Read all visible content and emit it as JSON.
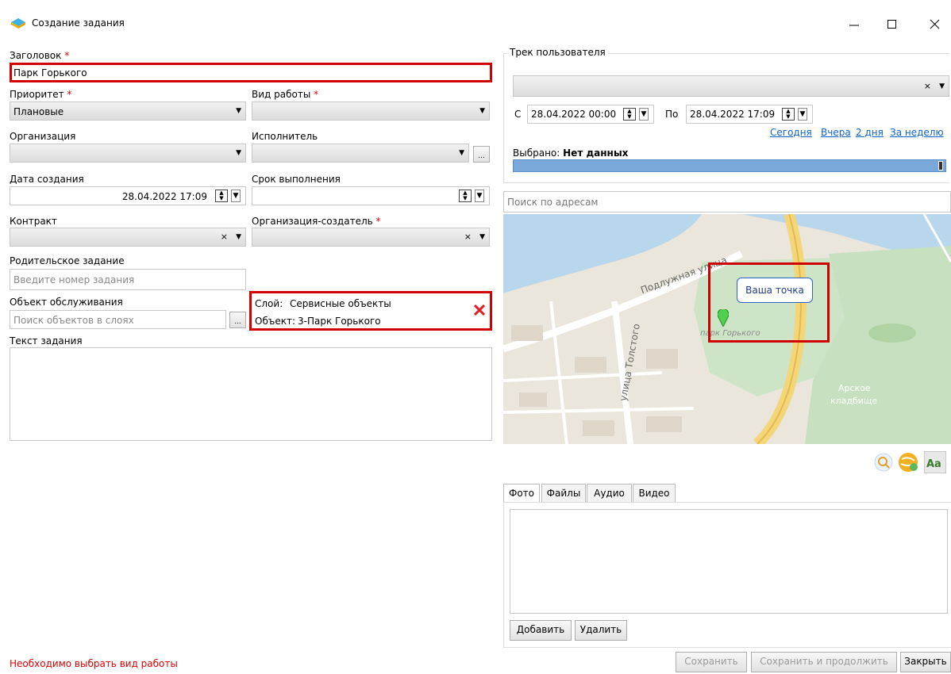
{
  "window": {
    "title": "Создание задания"
  },
  "left": {
    "title_label": "Заголовок",
    "title_value": "Парк Горького",
    "priority_label": "Приоритет",
    "priority_value": "Плановые",
    "worktype_label": "Вид работы",
    "org_label": "Организация",
    "executor_label": "Исполнитель",
    "created_label": "Дата создания",
    "created_value": "28.04.2022 17:09",
    "deadline_label": "Срок выполнения",
    "contract_label": "Контракт",
    "creator_org_label": "Организация-создатель",
    "parent_label": "Родительское задание",
    "parent_placeholder": "Введите номер задания",
    "object_label": "Объект обслуживания",
    "object_placeholder": "Поиск объектов в слоях",
    "layer_label": "Слой:",
    "layer_value": "Сервисные объекты",
    "object_info_label": "Объект:",
    "object_info_value": "3-Парк Горького",
    "text_label": "Текст задания",
    "ellipsis": "...",
    "error": "Необходимо выбрать вид работы"
  },
  "track": {
    "legend": "Трек пользователя",
    "from_label": "С",
    "from_value": "28.04.2022 00:00",
    "to_label": "По",
    "to_value": "28.04.2022 17:09",
    "links": [
      "Сегодня",
      "Вчера",
      "2 дня",
      "За неделю"
    ],
    "selected_label": "Выбрано:",
    "selected_value": "Нет данных"
  },
  "map": {
    "search_placeholder": "Поиск по адресам",
    "callout": "Ваша точка",
    "labels": {
      "street1": "Подлужная улица",
      "street2": "улица Толстого",
      "park": "парк Горького",
      "cemetery1": "Арское",
      "cemetery2": "кладбище"
    }
  },
  "media": {
    "tabs": [
      "Фото",
      "Файлы",
      "Аудио",
      "Видео"
    ],
    "add_label": "Добавить",
    "delete_label": "Удалить"
  },
  "footer": {
    "save": "Сохранить",
    "save_continue": "Сохранить и продолжить",
    "close": "Закрыть"
  },
  "colors": {
    "accent_red": "#d00000",
    "link": "#0f63c4",
    "progress": "#7aa8d8"
  }
}
